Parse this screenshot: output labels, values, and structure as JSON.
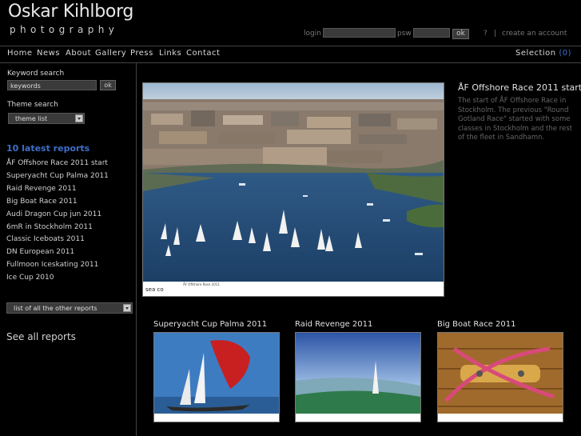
{
  "brand": {
    "name": "Oskar Kihlborg",
    "tagline": "photography"
  },
  "login": {
    "login_label": "login",
    "psw_label": "psw",
    "ok_label": "ok",
    "help_link": "?",
    "separator": "|",
    "create_account": "create an account"
  },
  "nav": {
    "items": [
      "Home",
      "News",
      "About",
      "Gallery",
      "Press",
      "Links",
      "Contact"
    ],
    "selection_label": "Selection",
    "selection_count": "(0)"
  },
  "sidebar": {
    "keyword_heading": "Keyword search",
    "keyword_placeholder": "keywords",
    "keyword_ok": "ok",
    "theme_heading": "Theme search",
    "theme_select": "theme list",
    "latest_heading": "10 latest reports",
    "reports": [
      "ÅF Offshore Race 2011 start",
      "Superyacht Cup Palma 2011",
      "Raid Revenge 2011",
      "Big Boat Race 2011",
      "Audi Dragon Cup jun 2011",
      "6mR in Stockholm 2011",
      "Classic Iceboats 2011",
      "DN European 2011",
      "Fullmoon Iceskating 2011",
      "Ice Cup 2010"
    ],
    "other_reports_select": "list of all the other reports",
    "see_all": "See all reports"
  },
  "feature": {
    "title": "ÅF Offshore Race 2011 start",
    "description": "The start of ÅF Offshore Race in Stockholm. The previous \"Round Gotland Race\" started with some classes in Stockholm and the rest of the fleet in Sandhamn.",
    "caption_logo": "sea co",
    "caption_title": "ÅF Offshore Race 2011"
  },
  "thumbs": [
    {
      "title": "Superyacht Cup Palma 2011"
    },
    {
      "title": "Raid Revenge 2011"
    },
    {
      "title": "Big Boat Race 2011"
    }
  ],
  "colors": {
    "accent": "#3e6fc8",
    "background": "#000000"
  }
}
